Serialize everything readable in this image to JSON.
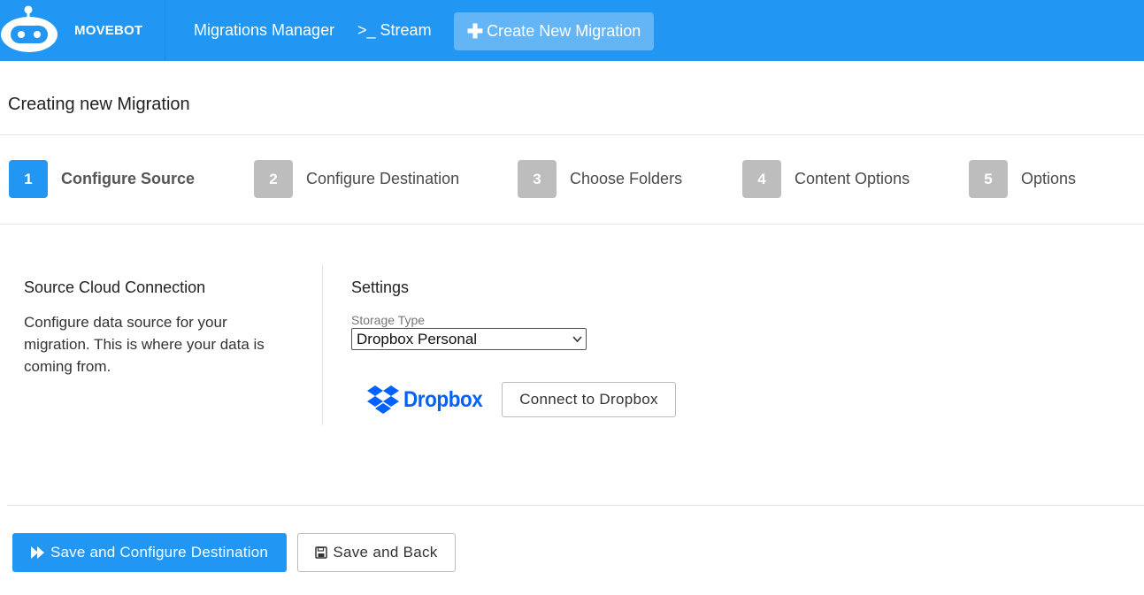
{
  "navbar": {
    "brand": "MOVEBOT",
    "logo_icon": "robot-icon",
    "links": [
      {
        "label": "Migrations Manager"
      },
      {
        "label": "Stream",
        "icon": "terminal-prompt-icon",
        "prefix": ">_"
      }
    ],
    "create_button": {
      "label": "Create New Migration",
      "icon": "plus-icon",
      "symbol": "✚"
    },
    "colors": {
      "bar": "#2196f3",
      "create_button": "#64b5f6"
    }
  },
  "page": {
    "title": "Creating new Migration"
  },
  "steps": [
    {
      "number": "1",
      "label": "Configure Source",
      "active": true
    },
    {
      "number": "2",
      "label": "Configure Destination",
      "active": false
    },
    {
      "number": "3",
      "label": "Choose Folders",
      "active": false
    },
    {
      "number": "4",
      "label": "Content Options",
      "active": false
    },
    {
      "number": "5",
      "label": "Options",
      "active": false
    }
  ],
  "source": {
    "title": "Source Cloud Connection",
    "description": "Configure data source for your migration. This is where your data is coming from."
  },
  "settings": {
    "title": "Settings",
    "storage_type_label": "Storage Type",
    "storage_type_value": "Dropbox Personal",
    "provider_logo": "Dropbox",
    "connect_button": "Connect to Dropbox"
  },
  "footer": {
    "primary_button": {
      "label": "Save and Configure Destination",
      "icon": "fast-forward-icon"
    },
    "secondary_button": {
      "label": "Save and Back",
      "icon": "floppy-disk-icon"
    }
  }
}
